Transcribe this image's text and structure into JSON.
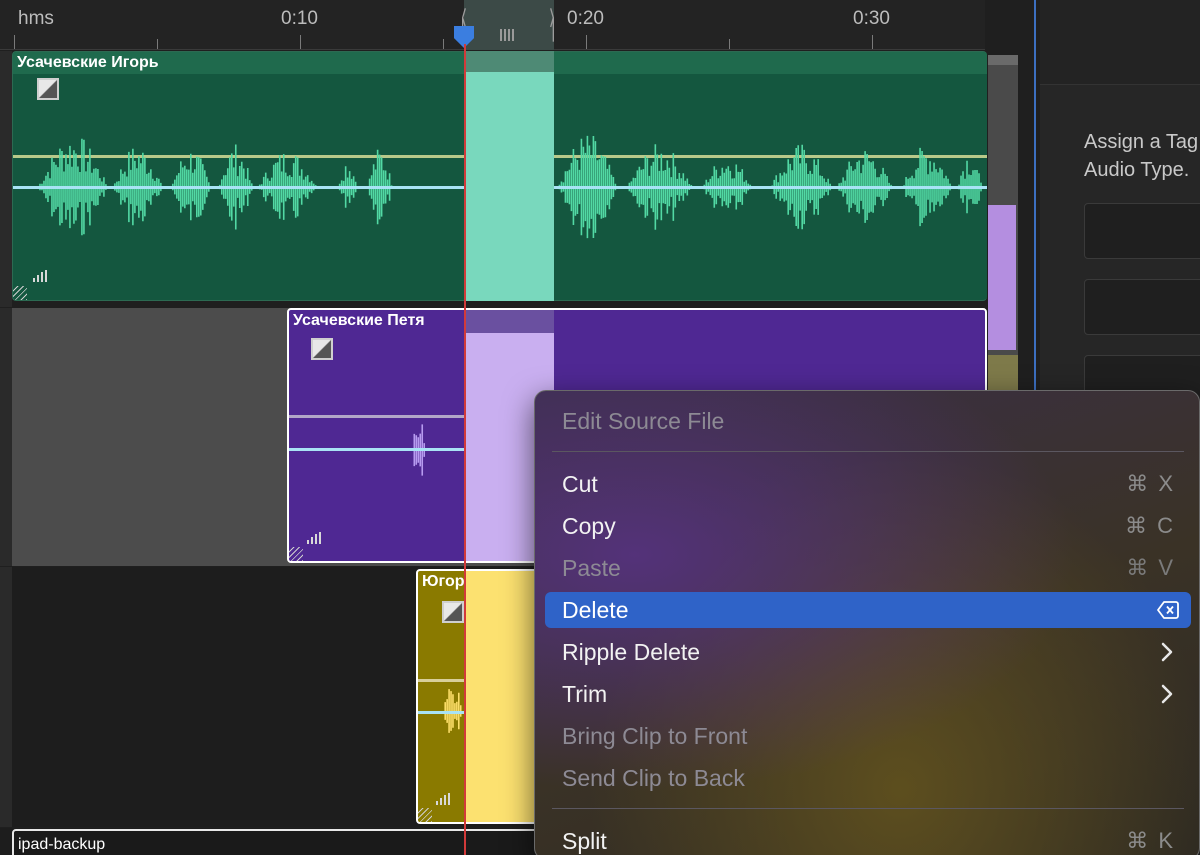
{
  "ruler": {
    "unit_label": "hms",
    "marks": [
      "0:10",
      "0:20",
      "0:30"
    ]
  },
  "tracks": [
    {
      "clip_name": "Усачевские Игорь",
      "color": "#14573f",
      "wave_color": "#52d9a4"
    },
    {
      "clip_name": "Усачевские Петя",
      "color": "#4f2893",
      "wave_color": "#b79bf0"
    },
    {
      "clip_name": "Югорский про",
      "color": "#8a7a00",
      "wave_color": "#ffe06a"
    },
    {
      "clip_name": "ipad-backup",
      "color": "#1a1a1a",
      "wave_color": "#cccccc"
    }
  ],
  "inspector": {
    "line1": "Assign a Tag",
    "line2": "Audio Type."
  },
  "context_menu": {
    "items": [
      {
        "label": "Edit Source File",
        "shortcut": "",
        "enabled": false
      },
      {
        "label": "Cut",
        "shortcut": "⌘ X",
        "enabled": true
      },
      {
        "label": "Copy",
        "shortcut": "⌘ C",
        "enabled": true
      },
      {
        "label": "Paste",
        "shortcut": "⌘ V",
        "enabled": false
      },
      {
        "label": "Delete",
        "shortcut": "",
        "enabled": true,
        "highlighted": true
      },
      {
        "label": "Ripple Delete",
        "shortcut": "",
        "enabled": true,
        "submenu": true
      },
      {
        "label": "Trim",
        "shortcut": "",
        "enabled": true,
        "submenu": true
      },
      {
        "label": "Bring Clip to Front",
        "shortcut": "",
        "enabled": false
      },
      {
        "label": "Send Clip to Back",
        "shortcut": "",
        "enabled": false
      },
      {
        "label": "Split",
        "shortcut": "⌘ K",
        "enabled": true
      }
    ]
  },
  "colors": {
    "accent": "#2f63c8",
    "playhead": "#d23a3a",
    "playhead_handle": "#3b7ee0"
  }
}
